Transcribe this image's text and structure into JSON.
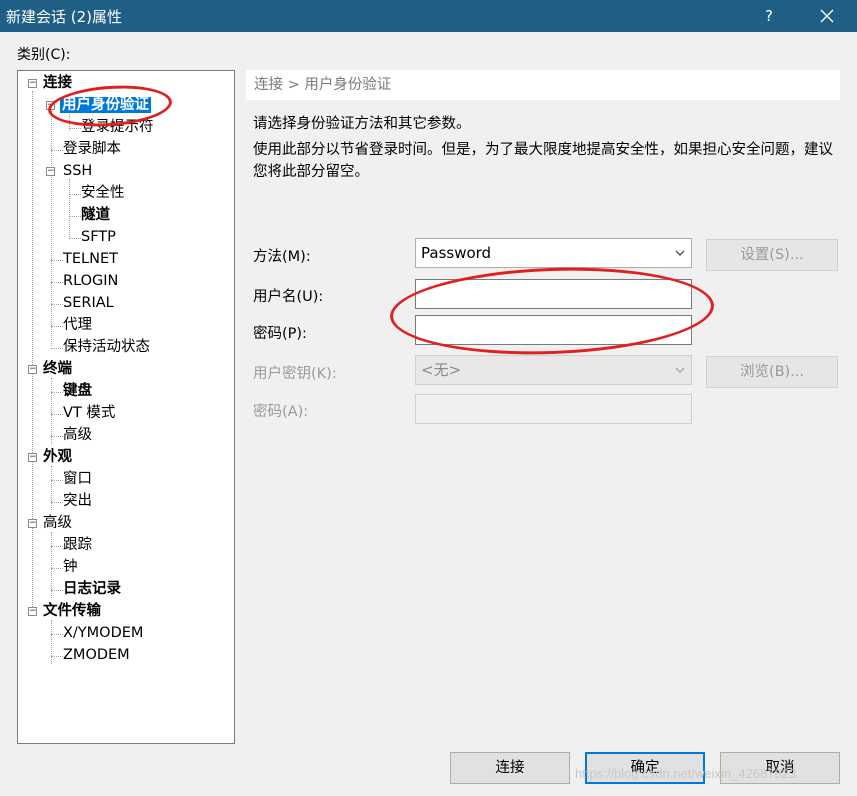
{
  "window": {
    "title": "新建会话 (2)属性",
    "help": "?"
  },
  "category_label": "类别(C):",
  "tree": {
    "connection": "连接",
    "auth": "用户身份验证",
    "login_prompt": "登录提示符",
    "login_script": "登录脚本",
    "ssh": "SSH",
    "security": "安全性",
    "tunnel": "隧道",
    "sftp": "SFTP",
    "telnet": "TELNET",
    "rlogin": "RLOGIN",
    "serial": "SERIAL",
    "proxy": "代理",
    "keepalive": "保持活动状态",
    "terminal": "终端",
    "keyboard": "键盘",
    "vt_mode": "VT 模式",
    "term_advanced": "高级",
    "appearance": "外观",
    "window": "窗口",
    "highlight": "突出",
    "advanced": "高级",
    "trace": "跟踪",
    "bell": "钟",
    "logging": "日志记录",
    "file_transfer": "文件传输",
    "xymodem": "X/YMODEM",
    "zmodem": "ZMODEM"
  },
  "breadcrumb": "连接 > 用户身份验证",
  "description": {
    "line1": "请选择身份验证方法和其它参数。",
    "line2": "使用此部分以节省登录时间。但是，为了最大限度地提高安全性，如果担心安全问题，建议您将此部分留空。"
  },
  "form": {
    "method_label": "方法(M):",
    "method_value": "Password",
    "settings_button": "设置(S)...",
    "username_label": "用户名(U):",
    "username_value": "",
    "password_label": "密码(P):",
    "password_value": "",
    "user_key_label": "用户密钥(K):",
    "user_key_value": "<无>",
    "browse_button": "浏览(B)...",
    "passphrase_label": "密码(A):",
    "passphrase_value": ""
  },
  "buttons": {
    "connect": "连接",
    "ok": "确定",
    "cancel": "取消"
  },
  "watermark": "https://blog.csdn.net/weixin_42687823",
  "colors": {
    "titlebar": "#1f5f86",
    "selection": "#0078d7",
    "annotation": "#e02020"
  }
}
